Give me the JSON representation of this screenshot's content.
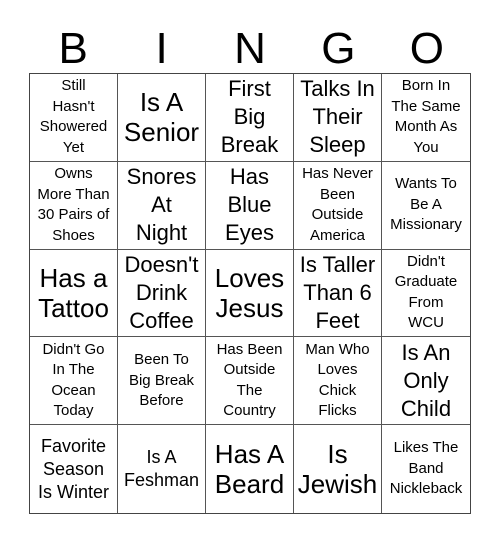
{
  "header": {
    "letters": [
      "B",
      "I",
      "N",
      "G",
      "O"
    ]
  },
  "cells": [
    {
      "text": "Still\nHasn't\nShowered\nYet",
      "size": "s-sm"
    },
    {
      "text": "Is A\nSenior",
      "size": "s-xl"
    },
    {
      "text": "First\nBig\nBreak",
      "size": "s-lg"
    },
    {
      "text": "Talks In\nTheir\nSleep",
      "size": "s-lg"
    },
    {
      "text": "Born In\nThe Same\nMonth As\nYou",
      "size": "s-sm"
    },
    {
      "text": "Owns\nMore Than\n30 Pairs of\nShoes",
      "size": "s-sm"
    },
    {
      "text": "Snores\nAt\nNight",
      "size": "s-lg"
    },
    {
      "text": "Has\nBlue\nEyes",
      "size": "s-lg"
    },
    {
      "text": "Has Never\nBeen\nOutside\nAmerica",
      "size": "s-sm"
    },
    {
      "text": "Wants To\nBe A\nMissionary",
      "size": "s-sm"
    },
    {
      "text": "Has a\nTattoo",
      "size": "s-xl"
    },
    {
      "text": "Doesn't\nDrink\nCoffee",
      "size": "s-lg"
    },
    {
      "text": "Loves\nJesus",
      "size": "s-xl"
    },
    {
      "text": "Is Taller\nThan 6\nFeet",
      "size": "s-lg"
    },
    {
      "text": "Didn't\nGraduate\nFrom\nWCU",
      "size": "s-sm"
    },
    {
      "text": "Didn't Go\nIn The\nOcean\nToday",
      "size": "s-sm"
    },
    {
      "text": "Been To\nBig Break\nBefore",
      "size": "s-sm"
    },
    {
      "text": "Has Been\nOutside\nThe\nCountry",
      "size": "s-sm"
    },
    {
      "text": "Man Who\nLoves\nChick\nFlicks",
      "size": "s-sm"
    },
    {
      "text": "Is An\nOnly\nChild",
      "size": "s-lg"
    },
    {
      "text": "Favorite\nSeason\nIs Winter",
      "size": "s-md"
    },
    {
      "text": "Is A\nFeshman",
      "size": "s-md"
    },
    {
      "text": "Has A\nBeard",
      "size": "s-xl"
    },
    {
      "text": "Is\nJewish",
      "size": "s-xl"
    },
    {
      "text": "Likes The\nBand\nNickleback",
      "size": "s-sm"
    }
  ]
}
